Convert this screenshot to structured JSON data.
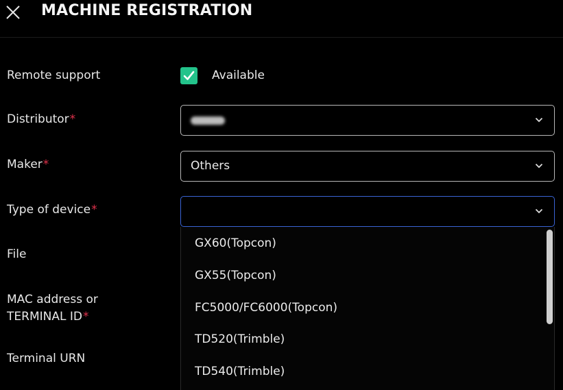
{
  "header": {
    "title": "MACHINE REGISTRATION"
  },
  "form": {
    "remote_support": {
      "label": "Remote support",
      "checked": true,
      "checkbox_label": "Available"
    },
    "distributor": {
      "label": "Distributor",
      "required_mark": "*"
    },
    "maker": {
      "label": "Maker",
      "required_mark": "*",
      "value": "Others"
    },
    "type_of_device": {
      "label": "Type of device",
      "required_mark": "*",
      "value": ""
    },
    "file": {
      "label": "File"
    },
    "mac_address": {
      "label_line1": "MAC address or",
      "label_line2": "TERMINAL ID",
      "required_mark": "*"
    },
    "terminal_urn": {
      "label": "Terminal URN"
    }
  },
  "dropdown": {
    "options": [
      "GX60(Topcon)",
      "GX55(Topcon)",
      "FC5000/FC6000(Topcon)",
      "TD520(Trimble)",
      "TD540(Trimble)"
    ]
  },
  "colors": {
    "background": "#000000",
    "accent_check": "#23c38b",
    "required": "#e0314b",
    "focus_border": "#3a64d6"
  },
  "icons": {
    "close": "close-icon",
    "check": "check-icon",
    "chevron": "chevron-down-icon"
  }
}
